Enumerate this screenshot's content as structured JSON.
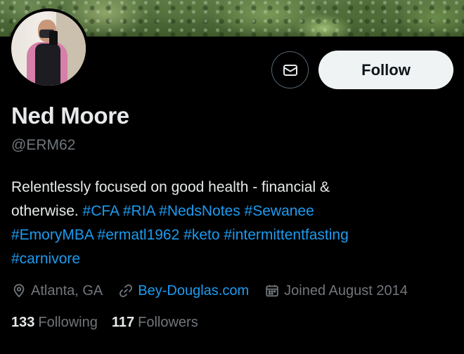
{
  "profile": {
    "name": "Ned Moore",
    "handle": "@ERM62",
    "bio": {
      "text_line1": "Relentlessly focused on good health - financial &",
      "text_line2_prefix": "otherwise. ",
      "hashtags": [
        "#CFA",
        "#RIA",
        "#NedsNotes",
        "#Sewanee",
        "#EmoryMBA",
        "#ermatl1962",
        "#keto",
        "#intermittentfasting",
        "#carnivore"
      ]
    },
    "location": "Atlanta, GA",
    "website": "Bey-Douglas.com",
    "joined": "Joined August 2014",
    "following_count": "133",
    "following_label": "Following",
    "followers_count": "117",
    "followers_label": "Followers"
  },
  "actions": {
    "follow_label": "Follow",
    "message_icon": "mail-icon"
  },
  "icons": {
    "location": "location-pin-icon",
    "website": "link-icon",
    "joined": "calendar-icon"
  },
  "colors": {
    "background": "#000000",
    "text_primary": "#e7e9ea",
    "text_secondary": "#71767b",
    "link": "#1d9bf0",
    "follow_bg": "#eff3f4",
    "follow_text": "#0f1419"
  }
}
